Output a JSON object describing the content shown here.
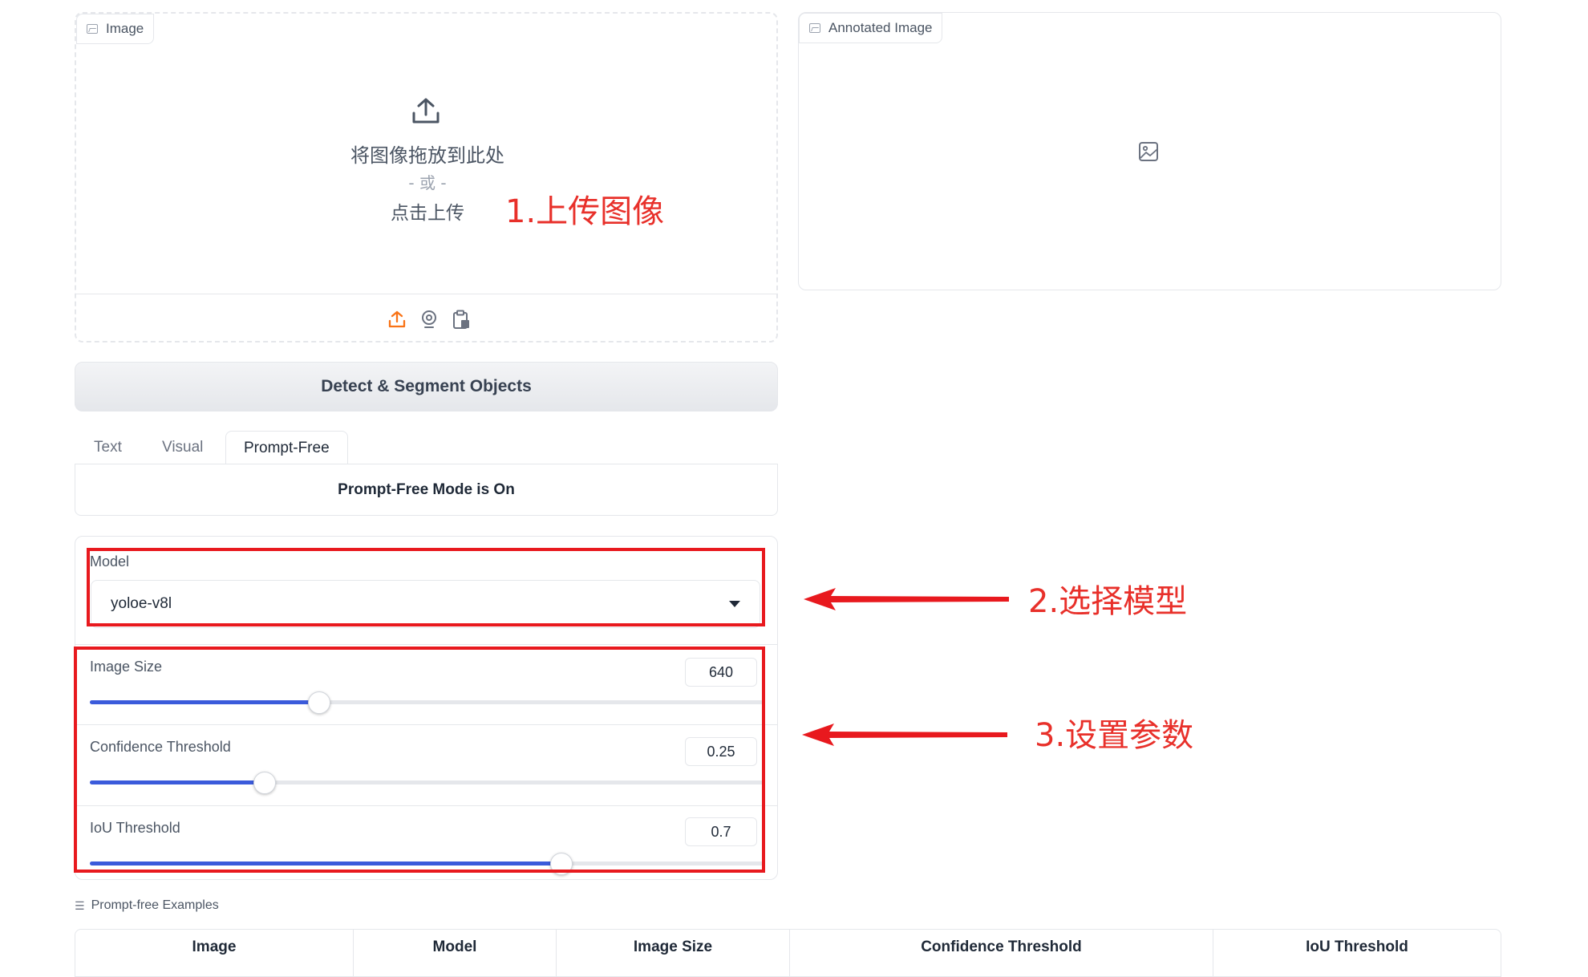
{
  "upload": {
    "label": "Image",
    "drop_text": "将图像拖放到此处",
    "or_text": "- 或 -",
    "click_text": "点击上传",
    "sources": [
      "upload-icon",
      "webcam-icon",
      "clipboard-icon"
    ]
  },
  "annotated": {
    "label": "Annotated Image"
  },
  "detect_button": "Detect & Segment Objects",
  "tabs": [
    {
      "label": "Text",
      "active": false
    },
    {
      "label": "Visual",
      "active": false
    },
    {
      "label": "Prompt-Free",
      "active": true
    }
  ],
  "prompt_free_message": "Prompt-Free Mode is On",
  "model": {
    "label": "Model",
    "value": "yoloe-v8l"
  },
  "sliders": [
    {
      "label": "Image Size",
      "value": "640",
      "fraction": 0.34
    },
    {
      "label": "Confidence Threshold",
      "value": "0.25",
      "fraction": 0.26
    },
    {
      "label": "IoU Threshold",
      "value": "0.7",
      "fraction": 0.7
    }
  ],
  "examples": {
    "label": "Prompt-free Examples",
    "columns": [
      "Image",
      "Model",
      "Image Size",
      "Confidence Threshold",
      "IoU Threshold"
    ]
  },
  "annotations": {
    "step1": "1.上传图像",
    "step2": "2.选择模型",
    "step3": "3.设置参数"
  },
  "colors": {
    "accent": "#3b5bdb",
    "annotation_red": "#e8191e",
    "upload_orange": "#f97316"
  }
}
